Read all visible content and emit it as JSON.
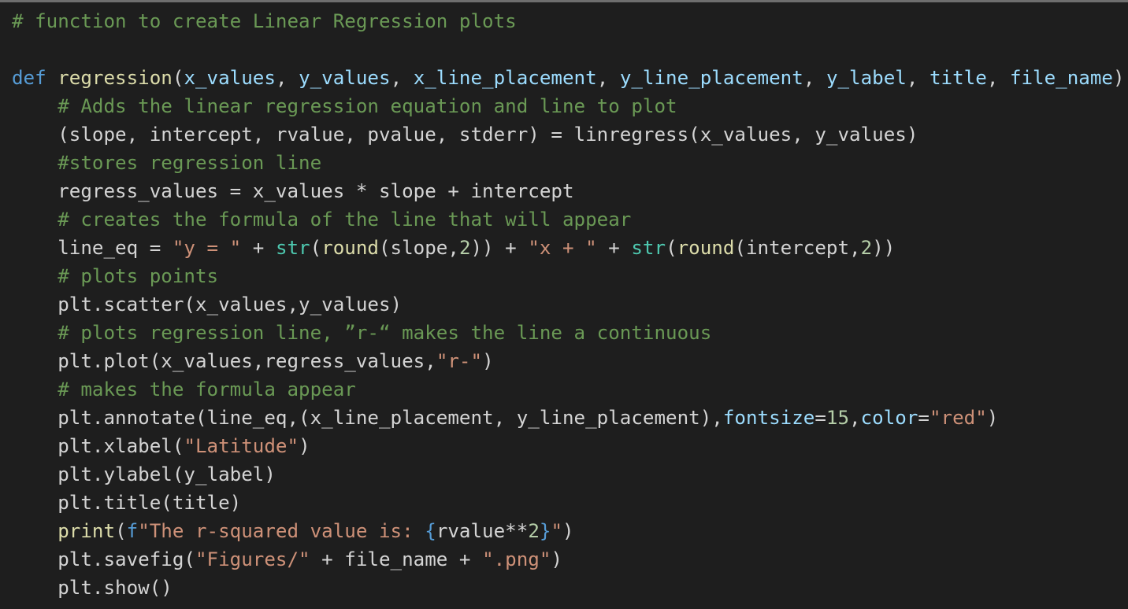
{
  "editor": {
    "colors": {
      "background": "#1e1e1e",
      "comment": "#6a9955",
      "keyword": "#569cd6",
      "function": "#dcdcaa",
      "param": "#9cdcfe",
      "string": "#ce9178",
      "number": "#b5cea8",
      "builtin": "#4ec9b0",
      "plain": "#d4d4d4"
    },
    "lines": [
      [
        {
          "t": "comment",
          "v": "# function to create Linear Regression plots"
        }
      ],
      [],
      [
        {
          "t": "keyword",
          "v": "def"
        },
        {
          "t": "plain",
          "v": " "
        },
        {
          "t": "function",
          "v": "regression"
        },
        {
          "t": "plain",
          "v": "("
        },
        {
          "t": "param",
          "v": "x_values"
        },
        {
          "t": "plain",
          "v": ", "
        },
        {
          "t": "param",
          "v": "y_values"
        },
        {
          "t": "plain",
          "v": ", "
        },
        {
          "t": "param",
          "v": "x_line_placement"
        },
        {
          "t": "plain",
          "v": ", "
        },
        {
          "t": "param",
          "v": "y_line_placement"
        },
        {
          "t": "plain",
          "v": ", "
        },
        {
          "t": "param",
          "v": "y_label"
        },
        {
          "t": "plain",
          "v": ", "
        },
        {
          "t": "param",
          "v": "title"
        },
        {
          "t": "plain",
          "v": ", "
        },
        {
          "t": "param",
          "v": "file_name"
        },
        {
          "t": "plain",
          "v": "):"
        }
      ],
      [
        {
          "t": "comment",
          "v": "    # Adds the linear regression equation and line to plot"
        }
      ],
      [
        {
          "t": "plain",
          "v": "    (slope, intercept, rvalue, pvalue, stderr) = linregress(x_values, y_values)"
        }
      ],
      [
        {
          "t": "comment",
          "v": "    #stores regression line"
        }
      ],
      [
        {
          "t": "plain",
          "v": "    regress_values = x_values * slope + intercept"
        }
      ],
      [
        {
          "t": "comment",
          "v": "    # creates the formula of the line that will appear"
        }
      ],
      [
        {
          "t": "plain",
          "v": "    line_eq = "
        },
        {
          "t": "string",
          "v": "\"y = \""
        },
        {
          "t": "plain",
          "v": " + "
        },
        {
          "t": "builtin",
          "v": "str"
        },
        {
          "t": "plain",
          "v": "("
        },
        {
          "t": "function",
          "v": "round"
        },
        {
          "t": "plain",
          "v": "(slope,"
        },
        {
          "t": "number",
          "v": "2"
        },
        {
          "t": "plain",
          "v": ")) + "
        },
        {
          "t": "string",
          "v": "\"x + \""
        },
        {
          "t": "plain",
          "v": " + "
        },
        {
          "t": "builtin",
          "v": "str"
        },
        {
          "t": "plain",
          "v": "("
        },
        {
          "t": "function",
          "v": "round"
        },
        {
          "t": "plain",
          "v": "(intercept,"
        },
        {
          "t": "number",
          "v": "2"
        },
        {
          "t": "plain",
          "v": "))"
        }
      ],
      [
        {
          "t": "comment",
          "v": "    # plots points"
        }
      ],
      [
        {
          "t": "plain",
          "v": "    plt.scatter(x_values,y_values)"
        }
      ],
      [
        {
          "t": "comment",
          "v": "    # plots regression line, ”r-“ makes the line a continuous"
        }
      ],
      [
        {
          "t": "plain",
          "v": "    plt.plot(x_values,regress_values,"
        },
        {
          "t": "string",
          "v": "\"r-\""
        },
        {
          "t": "plain",
          "v": ")"
        }
      ],
      [
        {
          "t": "comment",
          "v": "    # makes the formula appear"
        }
      ],
      [
        {
          "t": "plain",
          "v": "    plt.annotate(line_eq,(x_line_placement, y_line_placement),"
        },
        {
          "t": "param",
          "v": "fontsize"
        },
        {
          "t": "plain",
          "v": "="
        },
        {
          "t": "number",
          "v": "15"
        },
        {
          "t": "plain",
          "v": ","
        },
        {
          "t": "param",
          "v": "color"
        },
        {
          "t": "plain",
          "v": "="
        },
        {
          "t": "string",
          "v": "\"red\""
        },
        {
          "t": "plain",
          "v": ")"
        }
      ],
      [
        {
          "t": "plain",
          "v": "    plt.xlabel("
        },
        {
          "t": "string",
          "v": "\"Latitude\""
        },
        {
          "t": "plain",
          "v": ")"
        }
      ],
      [
        {
          "t": "plain",
          "v": "    plt.ylabel(y_label)"
        }
      ],
      [
        {
          "t": "plain",
          "v": "    plt.title(title)"
        }
      ],
      [
        {
          "t": "plain",
          "v": "    "
        },
        {
          "t": "function",
          "v": "print"
        },
        {
          "t": "plain",
          "v": "("
        },
        {
          "t": "keyword",
          "v": "f"
        },
        {
          "t": "string",
          "v": "\"The r-squared value is: "
        },
        {
          "t": "keyword",
          "v": "{"
        },
        {
          "t": "plain",
          "v": "rvalue**"
        },
        {
          "t": "number",
          "v": "2"
        },
        {
          "t": "keyword",
          "v": "}"
        },
        {
          "t": "string",
          "v": "\""
        },
        {
          "t": "plain",
          "v": ")"
        }
      ],
      [
        {
          "t": "plain",
          "v": "    plt.savefig("
        },
        {
          "t": "string",
          "v": "\"Figures/\""
        },
        {
          "t": "plain",
          "v": " + file_name + "
        },
        {
          "t": "string",
          "v": "\".png\""
        },
        {
          "t": "plain",
          "v": ")"
        }
      ],
      [
        {
          "t": "plain",
          "v": "    plt.show()"
        }
      ]
    ]
  }
}
